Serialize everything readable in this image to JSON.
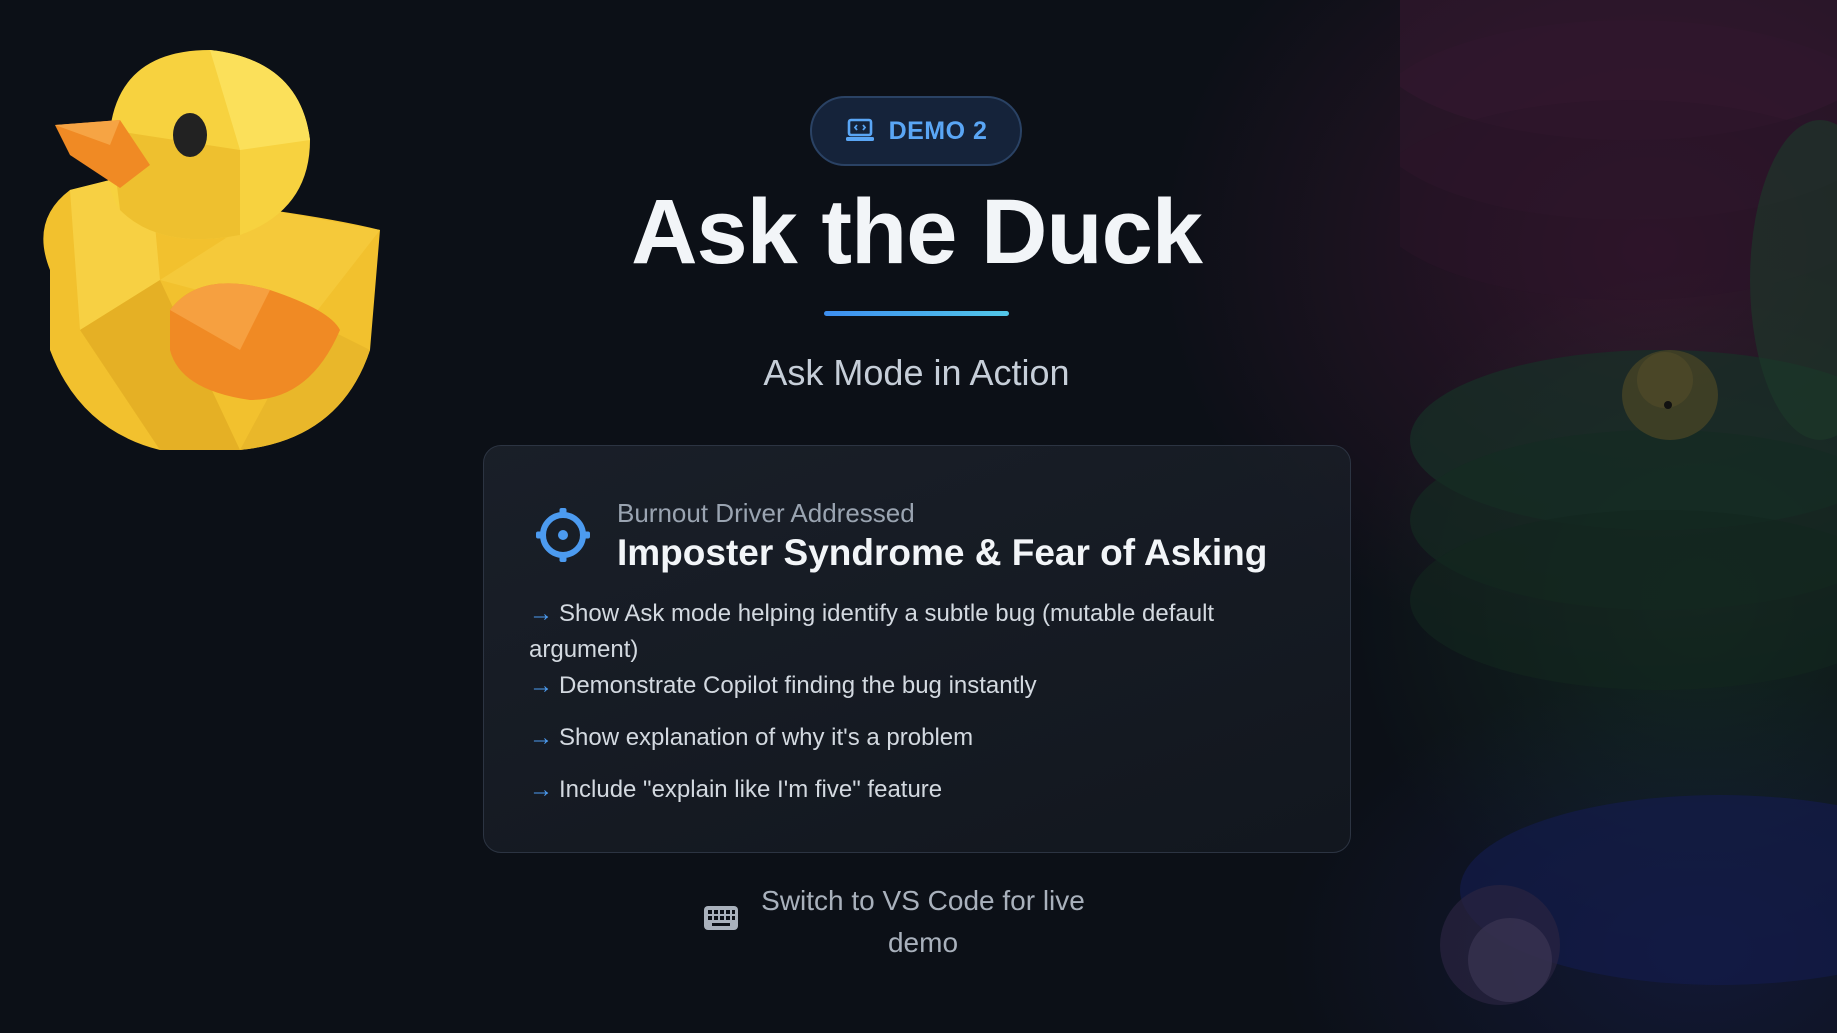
{
  "badge": {
    "icon": "laptop-code-icon",
    "label": "DEMO 2"
  },
  "title": "Ask the Duck",
  "subtitle": "Ask Mode in Action",
  "card": {
    "icon": "crosshair-target-icon",
    "kicker": "Burnout Driver Addressed",
    "heading": "Imposter Syndrome & Fear of Asking",
    "bullets": [
      "Show Ask mode helping identify a subtle bug (mutable default argument)",
      "Demonstrate Copilot finding the bug instantly",
      "Show explanation of why it's a problem",
      "Include \"explain like I'm five\" feature"
    ],
    "bullet_marker": "→"
  },
  "footer": {
    "icon": "keyboard-icon",
    "text": "Switch to VS Code for live demo"
  },
  "colors": {
    "background": "#0c1017",
    "accent": "#4c9bf0",
    "badge_bg": "#15233a",
    "duck": "#f4c430",
    "beak": "#f08a24"
  }
}
